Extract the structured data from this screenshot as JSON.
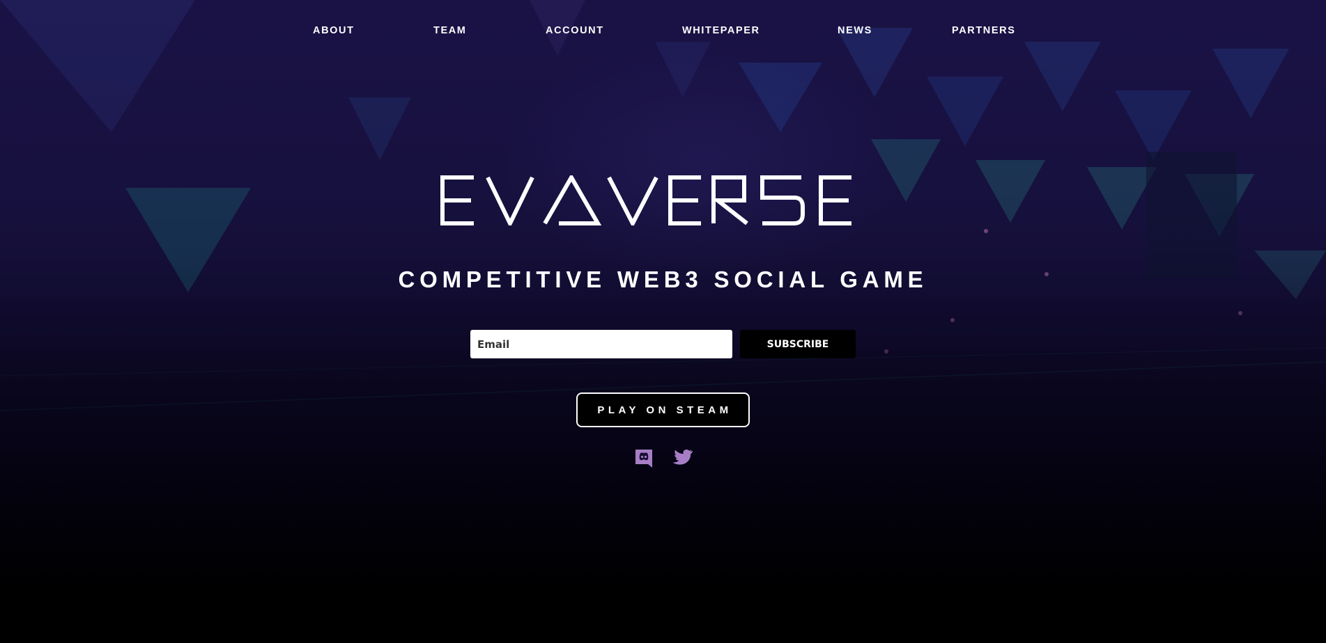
{
  "nav": {
    "items": [
      {
        "label": "ABOUT"
      },
      {
        "label": "TEAM"
      },
      {
        "label": "ACCOUNT"
      },
      {
        "label": "WHITEPAPER"
      },
      {
        "label": "NEWS"
      },
      {
        "label": "PARTNERS"
      }
    ]
  },
  "hero": {
    "logo_text": "EVAVERSE",
    "tagline": "COMPETITIVE WEB3 SOCIAL GAME"
  },
  "subscribe": {
    "email_placeholder": "Email",
    "button_label": "SUBSCRIBE"
  },
  "cta": {
    "steam_label": "PLAY ON STEAM"
  },
  "social": {
    "icons": [
      "discord-icon",
      "twitter-icon"
    ],
    "icon_color": "#a77ec6"
  },
  "colors": {
    "background_top": "#1c1448",
    "background_bottom": "#000000",
    "text": "#ffffff"
  }
}
